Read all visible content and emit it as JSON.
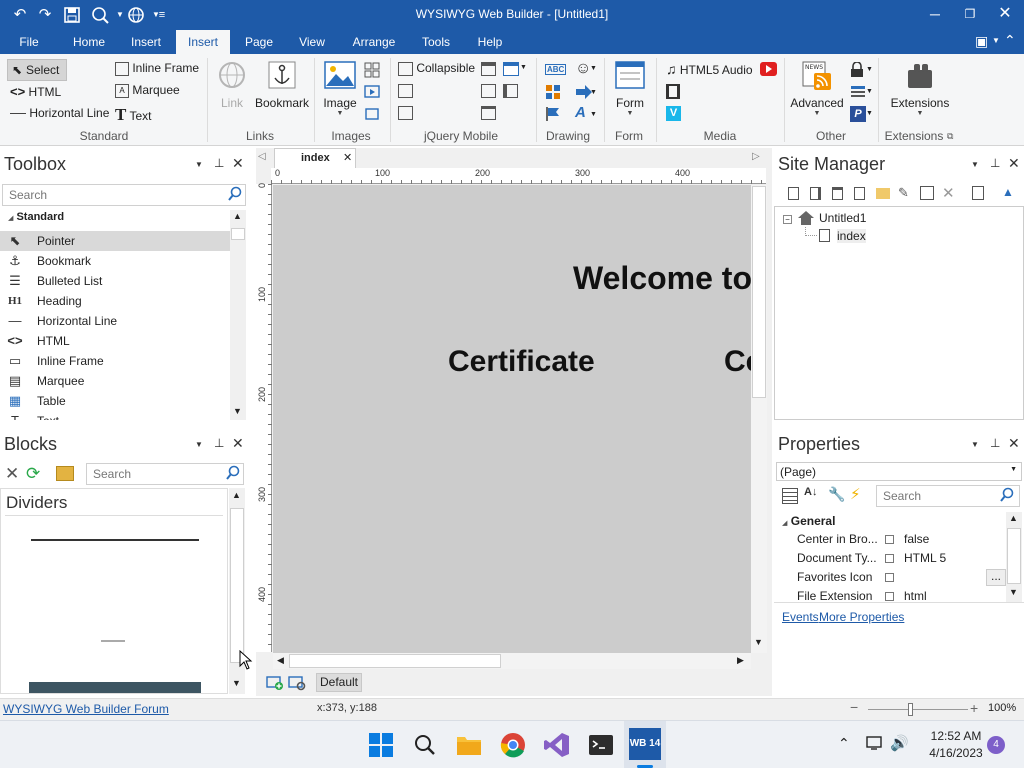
{
  "window": {
    "title": "WYSIWYG Web Builder - [Untitled1]"
  },
  "menu": {
    "tabs": [
      "File",
      "Home",
      "Insert",
      "Insert",
      "Page",
      "View",
      "Arrange",
      "Tools",
      "Help"
    ]
  },
  "ribbon": {
    "standard": {
      "select": "Select",
      "html": "HTML",
      "hline": "Horizontal Line",
      "iframe": "Inline Frame",
      "marquee": "Marquee",
      "text": "Text",
      "group": "Standard"
    },
    "links": {
      "link": "Link",
      "bookmark": "Bookmark",
      "group": "Links"
    },
    "images": {
      "image": "Image",
      "group": "Images"
    },
    "jquery": {
      "collapsible": "Collapsible",
      "group": "jQuery Mobile"
    },
    "drawing": {
      "group": "Drawing",
      "abc": "ABC"
    },
    "form": {
      "form": "Form",
      "group": "Form"
    },
    "media": {
      "audio": "HTML5 Audio",
      "group": "Media"
    },
    "other": {
      "advanced": "Advanced",
      "group": "Other"
    },
    "extensions": {
      "ext": "Extensions",
      "group": "Extensions"
    }
  },
  "toolbox": {
    "title": "Toolbox",
    "search_placeholder": "Search",
    "category": "Standard",
    "items": [
      "Pointer",
      "Bookmark",
      "Bulleted List",
      "Heading",
      "Horizontal Line",
      "HTML",
      "Inline Frame",
      "Marquee",
      "Table",
      "Text"
    ]
  },
  "blocks": {
    "title": "Blocks",
    "search_placeholder": "Search",
    "category": "Dividers"
  },
  "editor": {
    "tab": "index",
    "ruler_h": [
      "0",
      "100",
      "200",
      "300",
      "400"
    ],
    "ruler_v": [
      "0",
      "100",
      "200",
      "300",
      "400"
    ],
    "welcome": "Welcome to",
    "cert1": "Certificate",
    "cert2": "Ce",
    "layout": "Default"
  },
  "site": {
    "title": "Site Manager",
    "root": "Untitled1",
    "page": "index"
  },
  "props": {
    "title": "Properties",
    "selector": "(Page)",
    "search_placeholder": "Search",
    "group": "General",
    "rows": [
      {
        "name": "Center in Bro...",
        "value": "false"
      },
      {
        "name": "Document Ty...",
        "value": "HTML 5"
      },
      {
        "name": "Favorites Icon",
        "value": ""
      },
      {
        "name": "File Extension",
        "value": "html"
      }
    ],
    "events": "Events",
    "more": "More Properties"
  },
  "status": {
    "forum": "WYSIWYG Web Builder Forum",
    "coords": "x:373, y:188",
    "zoom": "100%"
  },
  "taskbar": {
    "time": "12:52 AM",
    "date": "4/16/2023",
    "badge": "4",
    "wb": "WB 14"
  },
  "colors": {
    "titlebar": "#1e5aa8",
    "accent": "#1e5aa8",
    "canvas": "#cccccc"
  }
}
